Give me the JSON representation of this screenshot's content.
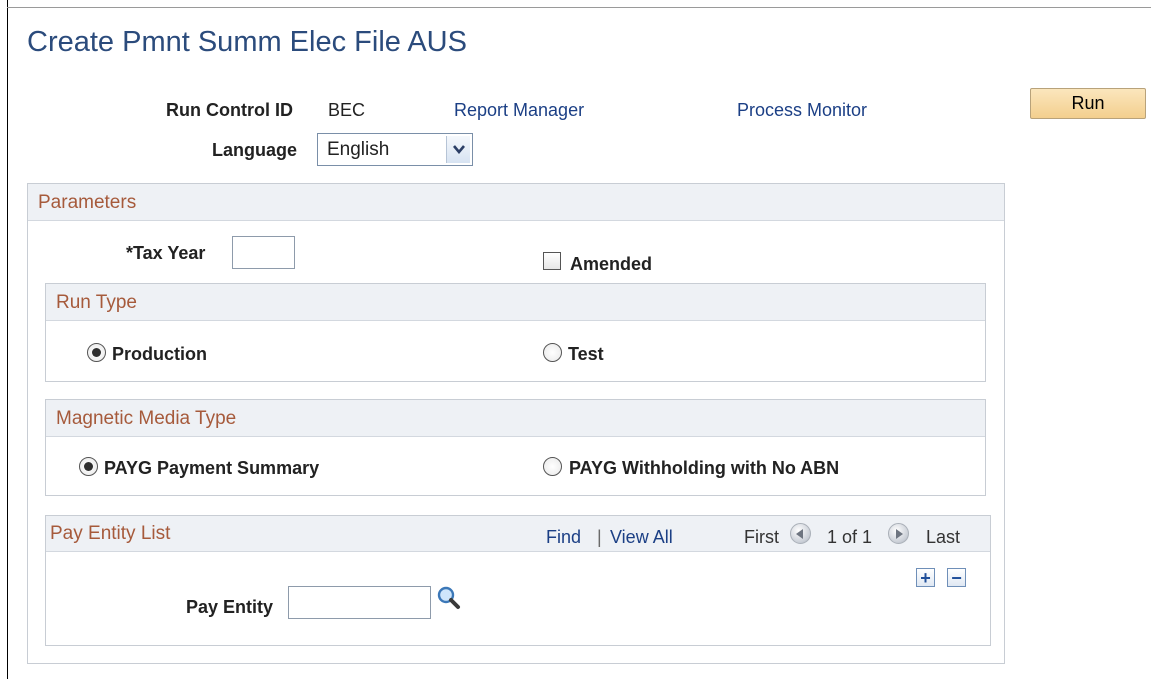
{
  "page": {
    "title": "Create Pmnt Summ Elec File AUS"
  },
  "run_control": {
    "id_label": "Run Control ID",
    "id_value": "BEC",
    "report_manager_link": "Report Manager",
    "process_monitor_link": "Process Monitor",
    "run_button": "Run",
    "language_label": "Language",
    "language_value": "English"
  },
  "parameters": {
    "header": "Parameters",
    "tax_year_label": "*Tax Year",
    "tax_year_value": "",
    "amended_label": "Amended",
    "amended_checked": false,
    "run_type": {
      "header": "Run Type",
      "options": [
        {
          "label": "Production",
          "selected": true
        },
        {
          "label": "Test",
          "selected": false
        }
      ]
    },
    "media_type": {
      "header": "Magnetic Media Type",
      "options": [
        {
          "label": "PAYG Payment Summary",
          "selected": true
        },
        {
          "label": "PAYG Withholding with No ABN",
          "selected": false
        }
      ]
    },
    "pay_entity_list": {
      "header": "Pay Entity List",
      "find_link": "Find",
      "separator": "|",
      "view_all_link": "View All",
      "first_label": "First",
      "page_indicator": "1 of 1",
      "last_label": "Last",
      "add_symbol": "+",
      "remove_symbol": "−",
      "pay_entity_label": "Pay Entity",
      "pay_entity_value": ""
    }
  },
  "icons": {
    "dropdown": "chevron-down-icon",
    "search": "magnifier-icon",
    "prev": "previous-arrow-icon",
    "next": "next-arrow-icon"
  },
  "colors": {
    "title": "#2b4b7c",
    "section_header_text": "#a65a3b",
    "link": "#1b3f85",
    "run_button": "#f3cf8e"
  }
}
